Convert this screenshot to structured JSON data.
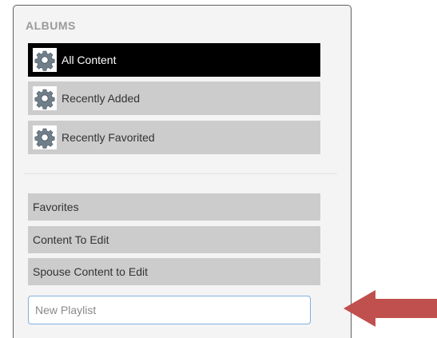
{
  "albums": {
    "heading": "ALBUMS",
    "smart_items": [
      {
        "label": "All Content",
        "icon": "gear-icon",
        "active": true
      },
      {
        "label": "Recently Added",
        "icon": "gear-icon",
        "active": false
      },
      {
        "label": "Recently Favorited",
        "icon": "gear-icon",
        "active": false
      }
    ],
    "playlists": [
      {
        "label": "Favorites"
      },
      {
        "label": "Content To Edit"
      },
      {
        "label": "Spouse Content to Edit"
      }
    ],
    "new_playlist": {
      "placeholder": "New Playlist",
      "value": ""
    }
  },
  "colors": {
    "active_bg": "#000000",
    "item_bg": "#cccccc",
    "arrow": "#c0504d",
    "input_border": "#7fb0e0"
  },
  "annotation": {
    "icon": "red-arrow-left-icon"
  }
}
